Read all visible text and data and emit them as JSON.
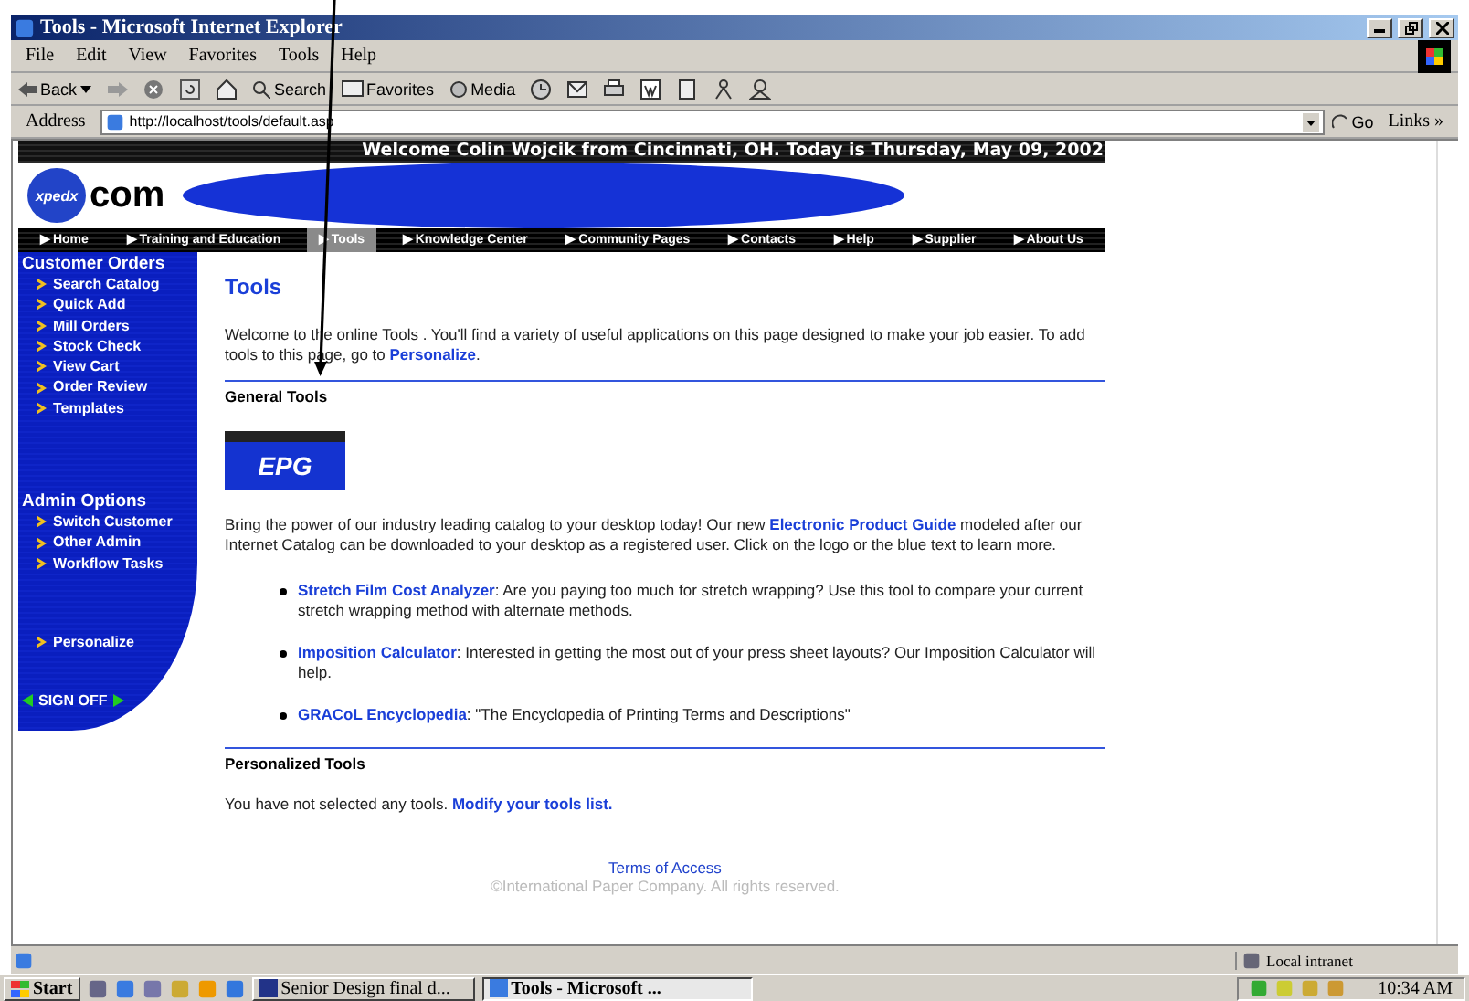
{
  "window": {
    "title": "Tools - Microsoft Internet Explorer"
  },
  "menu": [
    "File",
    "Edit",
    "View",
    "Favorites",
    "Tools",
    "Help"
  ],
  "toolbar": {
    "back": "Back",
    "search": "Search",
    "favorites": "Favorites",
    "media": "Media"
  },
  "address": {
    "label": "Address",
    "url": "http://localhost/tools/default.asp",
    "go": "Go",
    "links": "Links »"
  },
  "page": {
    "welcome": "Welcome Colin Wojcik from Cincinnati, OH. Today is Thursday, May 09, 2002",
    "logo": {
      "badge": "xpedx",
      "suffix": "com"
    },
    "nav": [
      {
        "label": "▶ Home",
        "selected": false
      },
      {
        "label": "▶ Training and Education",
        "selected": false
      },
      {
        "label": "▶ Tools",
        "selected": true
      },
      {
        "label": "▶ Knowledge Center",
        "selected": false
      },
      {
        "label": "▶ Community Pages",
        "selected": false
      },
      {
        "label": "▶ Contacts",
        "selected": false
      },
      {
        "label": "▶ Help",
        "selected": false
      },
      {
        "label": "▶ Supplier",
        "selected": false
      },
      {
        "label": "▶ About Us",
        "selected": false
      }
    ],
    "sidebar": {
      "sections": [
        {
          "heading": "Customer Orders",
          "items": [
            "Search Catalog",
            "Quick Add",
            "Mill Orders",
            "Stock Check",
            "View Cart",
            "Order Review",
            "Templates"
          ]
        },
        {
          "heading": "Admin Options",
          "items": [
            "Switch Customer",
            "Other Admin",
            "Workflow Tasks"
          ]
        },
        {
          "items": [
            "Personalize"
          ]
        }
      ],
      "sign_off": "SIGN OFF"
    },
    "main": {
      "title": "Tools",
      "intro": [
        {
          "text": "Welcome to the online Tools . You'll find a variety of useful applications on this page designed to make your job easier. To add tools to this page, go to "
        },
        {
          "link": "Personalize"
        },
        {
          "text": "."
        }
      ],
      "general_heading": "General Tools",
      "epg_logo": "EPG",
      "epg_text": [
        {
          "text": "Bring the power of our industry leading catalog to your desktop today! Our new "
        },
        {
          "link": "Electronic Product Guide"
        },
        {
          "text": " modeled after our Internet Catalog can be downloaded to your desktop as a registered user. Click on the logo or the blue text to learn more."
        }
      ],
      "tools": [
        {
          "name": "Stretch Film Cost Analyzer",
          "description": ": Are you paying too much for stretch wrapping? Use this tool to compare your current stretch wrapping method with alternate methods."
        },
        {
          "name": "Imposition Calculator",
          "description": ": Interested in getting the most out of your press sheet layouts? Our Imposition Calculator will help."
        },
        {
          "name": "GRACoL Encyclopedia",
          "description": ": \"The Encyclopedia of Printing Terms and Descriptions\""
        }
      ],
      "personalized_heading": "Personalized Tools",
      "personalized_text": [
        {
          "text": "You have not selected any tools. "
        },
        {
          "link": "Modify your tools list."
        }
      ],
      "terms": "Terms of Access",
      "copyright": "©International Paper Company. All rights reserved."
    }
  },
  "status": {
    "zone": "Local intranet"
  },
  "taskbar": {
    "start": "Start",
    "tasks": [
      {
        "label": "Senior Design final d...",
        "selected": false
      },
      {
        "label": "Tools - Microsoft ...",
        "selected": true
      }
    ],
    "clock": "10:34 AM"
  }
}
